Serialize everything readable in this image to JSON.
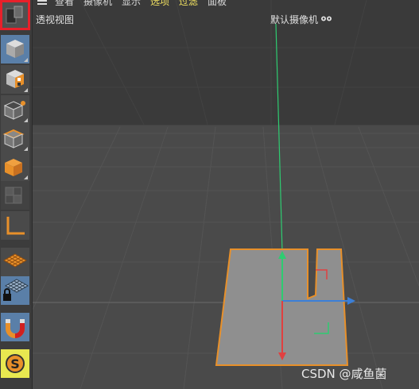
{
  "menu": {
    "items": [
      "查看",
      "摄像机",
      "显示",
      "选项",
      "过滤",
      "面板"
    ],
    "highlight": [
      3,
      4
    ]
  },
  "viewport": {
    "title": "透视视图",
    "camera": "默认摄像机"
  },
  "toolbar": {
    "tools": [
      {
        "name": "model-mode",
        "icon": "cube-icon",
        "active": true
      },
      {
        "name": "texture-mode",
        "icon": "checker-cube-icon",
        "active": false
      },
      {
        "name": "point-mode",
        "icon": "points-icon",
        "active": false
      },
      {
        "name": "edge-mode",
        "icon": "edges-icon",
        "active": false
      },
      {
        "name": "polygon-mode",
        "icon": "polygons-icon",
        "active": false
      },
      {
        "name": "uv-mode",
        "icon": "uv-icon",
        "active": false
      },
      {
        "name": "axis-mode",
        "icon": "axis-icon",
        "active": false
      },
      {
        "name": "workplane",
        "icon": "workplane-icon",
        "active": false
      },
      {
        "name": "locked-workplane",
        "icon": "locked-grid-icon",
        "active": true
      },
      {
        "name": "snap-toggle",
        "icon": "magnet-icon",
        "active": true
      },
      {
        "name": "snap-settings",
        "icon": "snap-s-icon",
        "active": false
      }
    ]
  },
  "watermark": "CSDN @咸鱼菌",
  "colors": {
    "accent_highlight": "#f0e060",
    "selection_outline": "#e8902a",
    "axis_x": "#3b7fd8",
    "axis_y": "#2ecc71",
    "axis_z": "#e04040",
    "red_frame": "#e8202a"
  }
}
